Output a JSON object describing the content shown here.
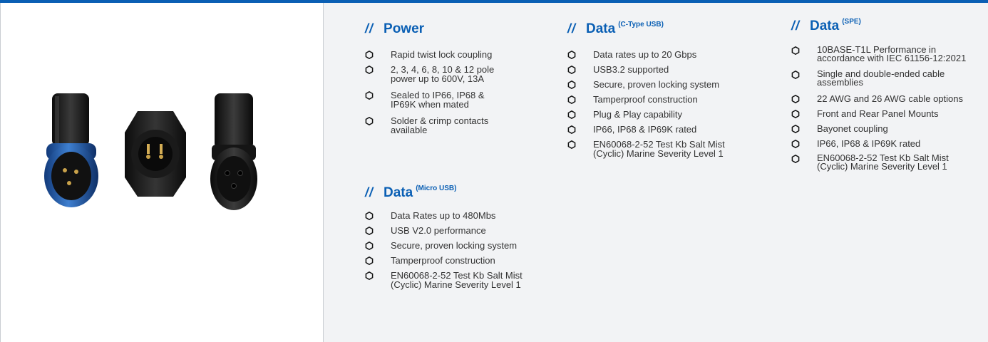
{
  "colors": {
    "accent": "#0a5fb4",
    "panel_bg": "#f2f3f5",
    "text": "#333333"
  },
  "icons": {
    "bullet": "hexagon-outline-icon"
  },
  "sections": {
    "power": {
      "slashes": "//",
      "title": "Power",
      "superscript": "",
      "items": [
        "Rapid twist lock coupling",
        "2, 3, 4, 6, 8, 10 & 12 pole\npower up to 600V, 13A",
        "Sealed to IP66, IP68 &\nIP69K when mated",
        "Solder & crimp contacts\navailable"
      ]
    },
    "data_micro": {
      "slashes": "//",
      "title": "Data",
      "superscript": "(Micro USB)",
      "items": [
        "Data Rates up to 480Mbs",
        "USB V2.0 performance",
        "Secure, proven locking system",
        "Tamperproof construction",
        "EN60068-2-52 Test Kb Salt Mist\n(Cyclic) Marine Severity Level 1"
      ]
    },
    "data_ctype": {
      "slashes": "//",
      "title": "Data",
      "superscript": "(C-Type USB)",
      "items": [
        "Data rates up to 20 Gbps",
        "USB3.2 supported",
        "Secure, proven locking system",
        "Tamperproof construction",
        "Plug & Play capability",
        "IP66, IP68 & IP69K rated",
        "EN60068-2-52 Test Kb Salt Mist\n(Cyclic) Marine Severity Level 1"
      ]
    },
    "data_spe": {
      "slashes": "//",
      "title": "Data",
      "superscript": "(SPE)",
      "items": [
        "10BASE-T1L Performance in\naccordance with IEC 61156-12:2021",
        "Single and double-ended cable\nassemblies",
        "22 AWG and 26 AWG cable options",
        "Front and Rear Panel Mounts",
        "Bayonet coupling",
        "IP66, IP68 & IP69K rated",
        "EN60068-2-52 Test Kb Salt Mist\n(Cyclic) Marine Severity Level 1"
      ]
    }
  }
}
